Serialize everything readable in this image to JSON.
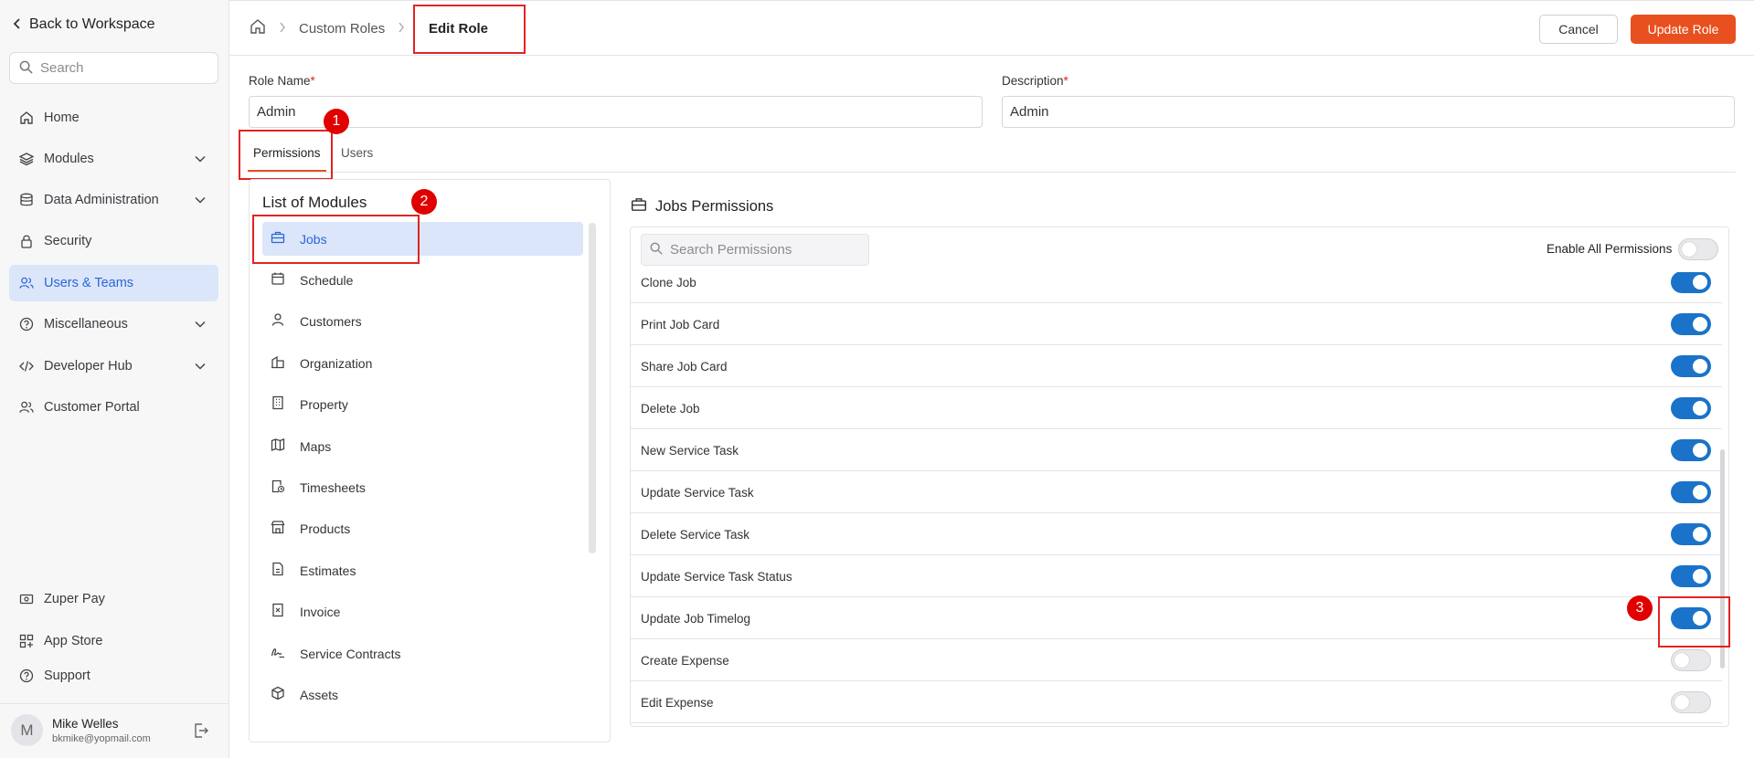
{
  "sidebar": {
    "back_label": "Back to Workspace",
    "search_placeholder": "Search",
    "items": [
      {
        "label": "Home"
      },
      {
        "label": "Modules"
      },
      {
        "label": "Data Administration"
      },
      {
        "label": "Security"
      },
      {
        "label": "Users & Teams"
      },
      {
        "label": "Miscellaneous"
      },
      {
        "label": "Developer Hub"
      },
      {
        "label": "Customer Portal"
      }
    ],
    "bottom_items": [
      {
        "label": "Zuper Pay"
      },
      {
        "label": "App Store"
      },
      {
        "label": "Support"
      }
    ],
    "user": {
      "initial": "M",
      "name": "Mike Welles",
      "email": "bkmike@yopmail.com"
    }
  },
  "header": {
    "breadcrumb": [
      "Custom Roles",
      "Edit Role"
    ],
    "cancel_label": "Cancel",
    "update_label": "Update Role"
  },
  "form": {
    "role_name_label": "Role Name",
    "role_name_value": "Admin",
    "description_label": "Description",
    "description_value": "Admin",
    "required_mark": "*"
  },
  "tabs": [
    "Permissions",
    "Users"
  ],
  "markers": [
    "1",
    "2",
    "3"
  ],
  "modules": {
    "title": "List of Modules",
    "items": [
      "Jobs",
      "Schedule",
      "Customers",
      "Organization",
      "Property",
      "Maps",
      "Timesheets",
      "Products",
      "Estimates",
      "Invoice",
      "Service Contracts",
      "Assets"
    ]
  },
  "permissions": {
    "title": "Jobs Permissions",
    "search_placeholder": "Search Permissions",
    "enable_all_label": "Enable All Permissions",
    "enable_all_on": false,
    "rows": [
      {
        "label": "Clone Job",
        "on": true
      },
      {
        "label": "Print Job Card",
        "on": true
      },
      {
        "label": "Share Job Card",
        "on": true
      },
      {
        "label": "Delete Job",
        "on": true
      },
      {
        "label": "New Service Task",
        "on": true
      },
      {
        "label": "Update Service Task",
        "on": true
      },
      {
        "label": "Delete Service Task",
        "on": true
      },
      {
        "label": "Update Service Task Status",
        "on": true
      },
      {
        "label": "Update Job Timelog",
        "on": true
      },
      {
        "label": "Create Expense",
        "on": false
      },
      {
        "label": "Edit Expense",
        "on": false
      }
    ]
  },
  "colors": {
    "accent": "#e8501f",
    "toggle_on": "#1a73c8",
    "active_bg": "#dbe6fb",
    "active_text": "#2b66d6",
    "annotation": "#e02424"
  }
}
